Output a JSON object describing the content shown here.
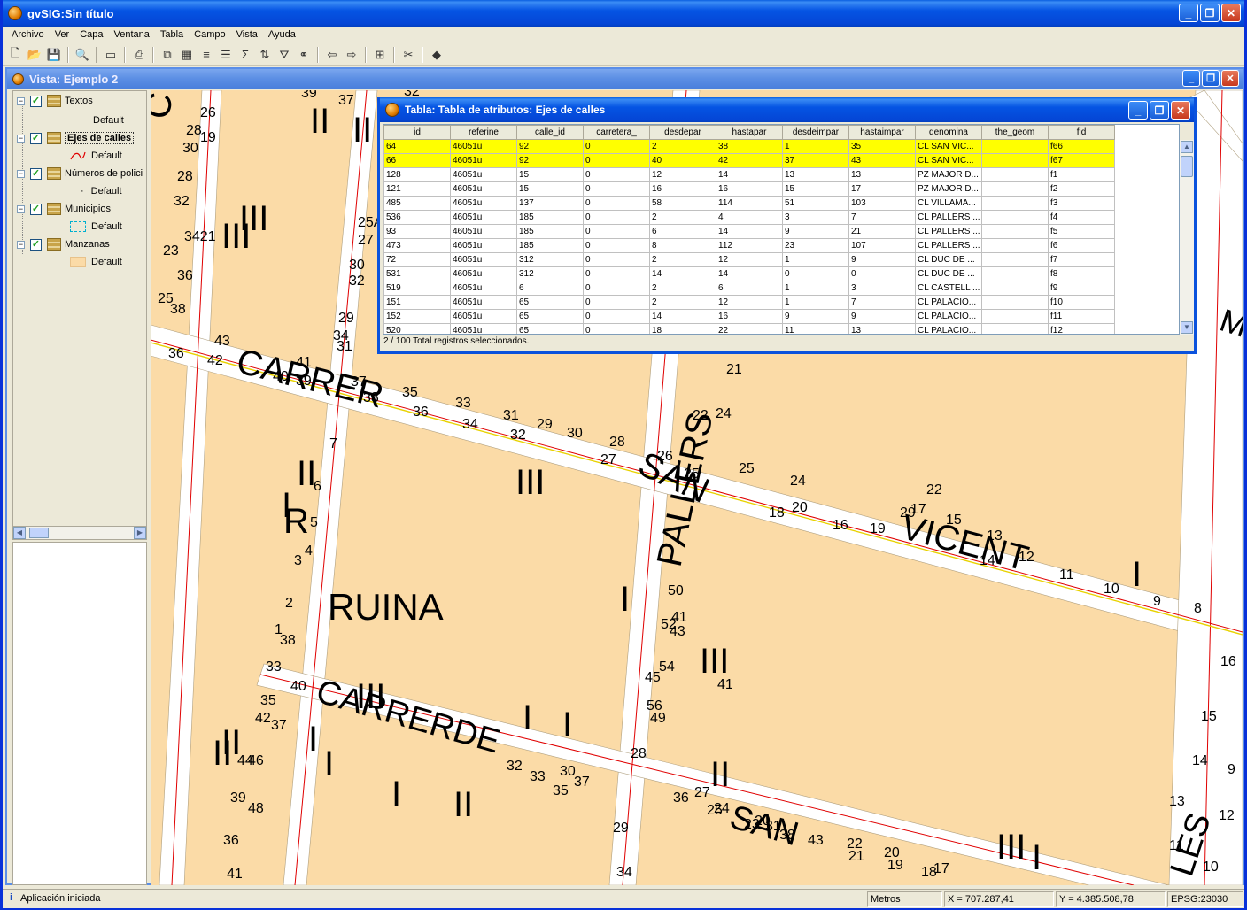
{
  "app": {
    "title": "gvSIG:Sin título"
  },
  "menu": [
    "Archivo",
    "Ver",
    "Capa",
    "Ventana",
    "Tabla",
    "Campo",
    "Vista",
    "Ayuda"
  ],
  "view": {
    "title": "Vista: Ejemplo 2",
    "toc": {
      "layers": [
        {
          "name": "Textos",
          "legend": "Default",
          "checked": true
        },
        {
          "name": "Ejes de calles",
          "legend": "Default",
          "checked": true,
          "selected": true
        },
        {
          "name": "Números de polici",
          "legend": "Default",
          "checked": true
        },
        {
          "name": "Municipios",
          "legend": "Default",
          "checked": true
        },
        {
          "name": "Manzanas",
          "legend": "Default",
          "checked": true
        }
      ]
    }
  },
  "table_window": {
    "title": "Tabla: Tabla de atributos: Ejes de calles",
    "columns": [
      "id",
      "referine",
      "calle_id",
      "carretera_",
      "desdepar",
      "hastapar",
      "desdeimpar",
      "hastaimpar",
      "denomina",
      "the_geom",
      "fid"
    ],
    "rows": [
      [
        "64",
        "46051u",
        "92",
        "0",
        "2",
        "38",
        "1",
        "35",
        "CL SAN VIC...",
        "",
        "f66"
      ],
      [
        "66",
        "46051u",
        "92",
        "0",
        "40",
        "42",
        "37",
        "43",
        "CL SAN VIC...",
        "",
        "f67"
      ],
      [
        "128",
        "46051u",
        "15",
        "0",
        "12",
        "14",
        "13",
        "13",
        "PZ MAJOR D...",
        "",
        "f1"
      ],
      [
        "121",
        "46051u",
        "15",
        "0",
        "16",
        "16",
        "15",
        "17",
        "PZ MAJOR D...",
        "",
        "f2"
      ],
      [
        "485",
        "46051u",
        "137",
        "0",
        "58",
        "114",
        "51",
        "103",
        "CL VILLAMA...",
        "",
        "f3"
      ],
      [
        "536",
        "46051u",
        "185",
        "0",
        "2",
        "4",
        "3",
        "7",
        "CL PALLERS ...",
        "",
        "f4"
      ],
      [
        "93",
        "46051u",
        "185",
        "0",
        "6",
        "14",
        "9",
        "21",
        "CL PALLERS ...",
        "",
        "f5"
      ],
      [
        "473",
        "46051u",
        "185",
        "0",
        "8",
        "112",
        "23",
        "107",
        "CL PALLERS ...",
        "",
        "f6"
      ],
      [
        "72",
        "46051u",
        "312",
        "0",
        "2",
        "12",
        "1",
        "9",
        "CL DUC DE ...",
        "",
        "f7"
      ],
      [
        "531",
        "46051u",
        "312",
        "0",
        "14",
        "14",
        "0",
        "0",
        "CL DUC DE ...",
        "",
        "f8"
      ],
      [
        "519",
        "46051u",
        "6",
        "0",
        "2",
        "6",
        "1",
        "3",
        "CL CASTELL ...",
        "",
        "f9"
      ],
      [
        "151",
        "46051u",
        "65",
        "0",
        "2",
        "12",
        "1",
        "7",
        "CL PALACIO...",
        "",
        "f10"
      ],
      [
        "152",
        "46051u",
        "65",
        "0",
        "14",
        "16",
        "9",
        "9",
        "CL PALACIO...",
        "",
        "f11"
      ],
      [
        "520",
        "46051u",
        "65",
        "0",
        "18",
        "22",
        "11",
        "13",
        "CL PALACIO...",
        "",
        "f12"
      ]
    ],
    "selected_rows": 2,
    "status": "2 / 100 Total registros seleccionados."
  },
  "map": {
    "street_labels": [
      "CARRER",
      "SAN",
      "VICENT",
      "PALLERS",
      "CARRERDE",
      "SAN",
      "LES",
      "RUINA",
      "C",
      "R",
      "M"
    ],
    "numbers": [
      "39",
      "37",
      "32",
      "28",
      "26",
      "30",
      "19",
      "28",
      "32",
      "3421",
      "23",
      "36",
      "25",
      "38",
      "25A",
      "27",
      "30",
      "32",
      "29",
      "34",
      "31",
      "36",
      "43",
      "42",
      "41",
      "40",
      "39",
      "37",
      "38",
      "35",
      "36",
      "33",
      "34",
      "31",
      "32",
      "29",
      "30",
      "28",
      "27",
      "26",
      "25",
      "24",
      "21",
      "22",
      "25",
      "24",
      "29",
      "22",
      "20",
      "18",
      "16",
      "19",
      "17",
      "15",
      "13",
      "14",
      "12",
      "11",
      "10",
      "9",
      "8",
      "7",
      "6",
      "5",
      "4",
      "3",
      "2",
      "1",
      "38",
      "33",
      "40",
      "35",
      "42",
      "37",
      "44",
      "46",
      "39",
      "48",
      "36",
      "41",
      "50",
      "41",
      "52",
      "43",
      "54",
      "45",
      "56",
      "49",
      "28",
      "33",
      "30",
      "35",
      "37",
      "32",
      "29",
      "34",
      "41",
      "36",
      "27",
      "24",
      "25",
      "23",
      "20",
      "31",
      "38",
      "43",
      "22",
      "21",
      "20",
      "19",
      "18",
      "17",
      "16",
      "15",
      "14",
      "13",
      "12",
      "11",
      "10",
      "9",
      "8",
      "7",
      "20",
      "22",
      "24",
      "26",
      "29",
      "28",
      "31",
      "27",
      "21"
    ]
  },
  "statusbar": {
    "message": "Aplicación iniciada",
    "units": "Metros",
    "x": "X = 707.287,41",
    "y": "Y = 4.385.508,78",
    "epsg": "EPSG:23030"
  },
  "colors": {
    "block_fill": "#fbdba7",
    "street": "#ffffff",
    "street_axis": "#e00000",
    "selected_row": "#ffff00",
    "titlebar": "#0554e3"
  }
}
